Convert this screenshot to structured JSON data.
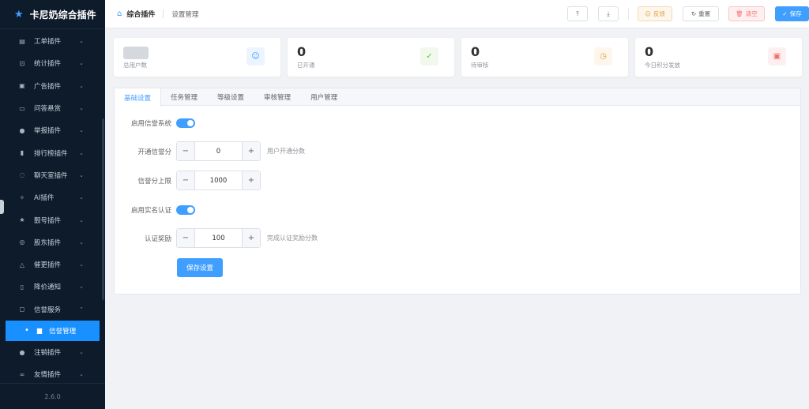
{
  "sidebar": {
    "title": "卡尼奶综合插件",
    "items": [
      {
        "label": "工单插件",
        "icon": "document-icon"
      },
      {
        "label": "统计插件",
        "icon": "cart-icon"
      },
      {
        "label": "广告插件",
        "icon": "image-icon"
      },
      {
        "label": "问答悬赏",
        "icon": "chat-icon"
      },
      {
        "label": "举报插件",
        "icon": "warning-icon"
      },
      {
        "label": "排行榜插件",
        "icon": "bar-chart-icon"
      },
      {
        "label": "聊天室插件",
        "icon": "message-icon"
      },
      {
        "label": "AI插件",
        "icon": "magic-icon"
      },
      {
        "label": "靓号插件",
        "icon": "star-icon"
      },
      {
        "label": "股东插件",
        "icon": "database-icon"
      },
      {
        "label": "催更插件",
        "icon": "bell-icon"
      },
      {
        "label": "降价通知",
        "icon": "phone-icon"
      },
      {
        "label": "信誉服务",
        "icon": "cup-icon"
      }
    ],
    "active_sub": "信誉管理",
    "items_after": [
      {
        "label": "注销插件",
        "icon": "user-icon"
      },
      {
        "label": "友情插件",
        "icon": "link-icon"
      }
    ],
    "version": "2.6.0"
  },
  "header": {
    "breadcrumb_main": "综合插件",
    "breadcrumb_sub": "设置管理",
    "buttons": {
      "feedback": "反馈",
      "reset": "重置",
      "clear": "清空",
      "save": "保存"
    }
  },
  "stats": [
    {
      "value": "",
      "label": "总用户数",
      "icon": "user-icon",
      "blurred": true
    },
    {
      "value": "0",
      "label": "已开通",
      "icon": "check-icon"
    },
    {
      "value": "0",
      "label": "待审核",
      "icon": "clock-icon"
    },
    {
      "value": "0",
      "label": "今日积分发放",
      "icon": "gift-icon"
    }
  ],
  "tabs": [
    "基础设置",
    "任务管理",
    "等级设置",
    "审核管理",
    "用户管理"
  ],
  "form": {
    "enable_credit_label": "启用信誉系统",
    "init_score_label": "开通信誉分",
    "init_score_value": "0",
    "init_score_hint": "用户开通分数",
    "max_score_label": "信誉分上限",
    "max_score_value": "1000",
    "enable_realname_label": "启用实名认证",
    "reward_label": "认证奖励",
    "reward_value": "100",
    "reward_hint": "完成认证奖励分数",
    "save_label": "保存设置"
  },
  "colors": {
    "sidebar_bg": "#0d1b2a",
    "accent": "#409eff",
    "active_menu": "#1890ff"
  }
}
